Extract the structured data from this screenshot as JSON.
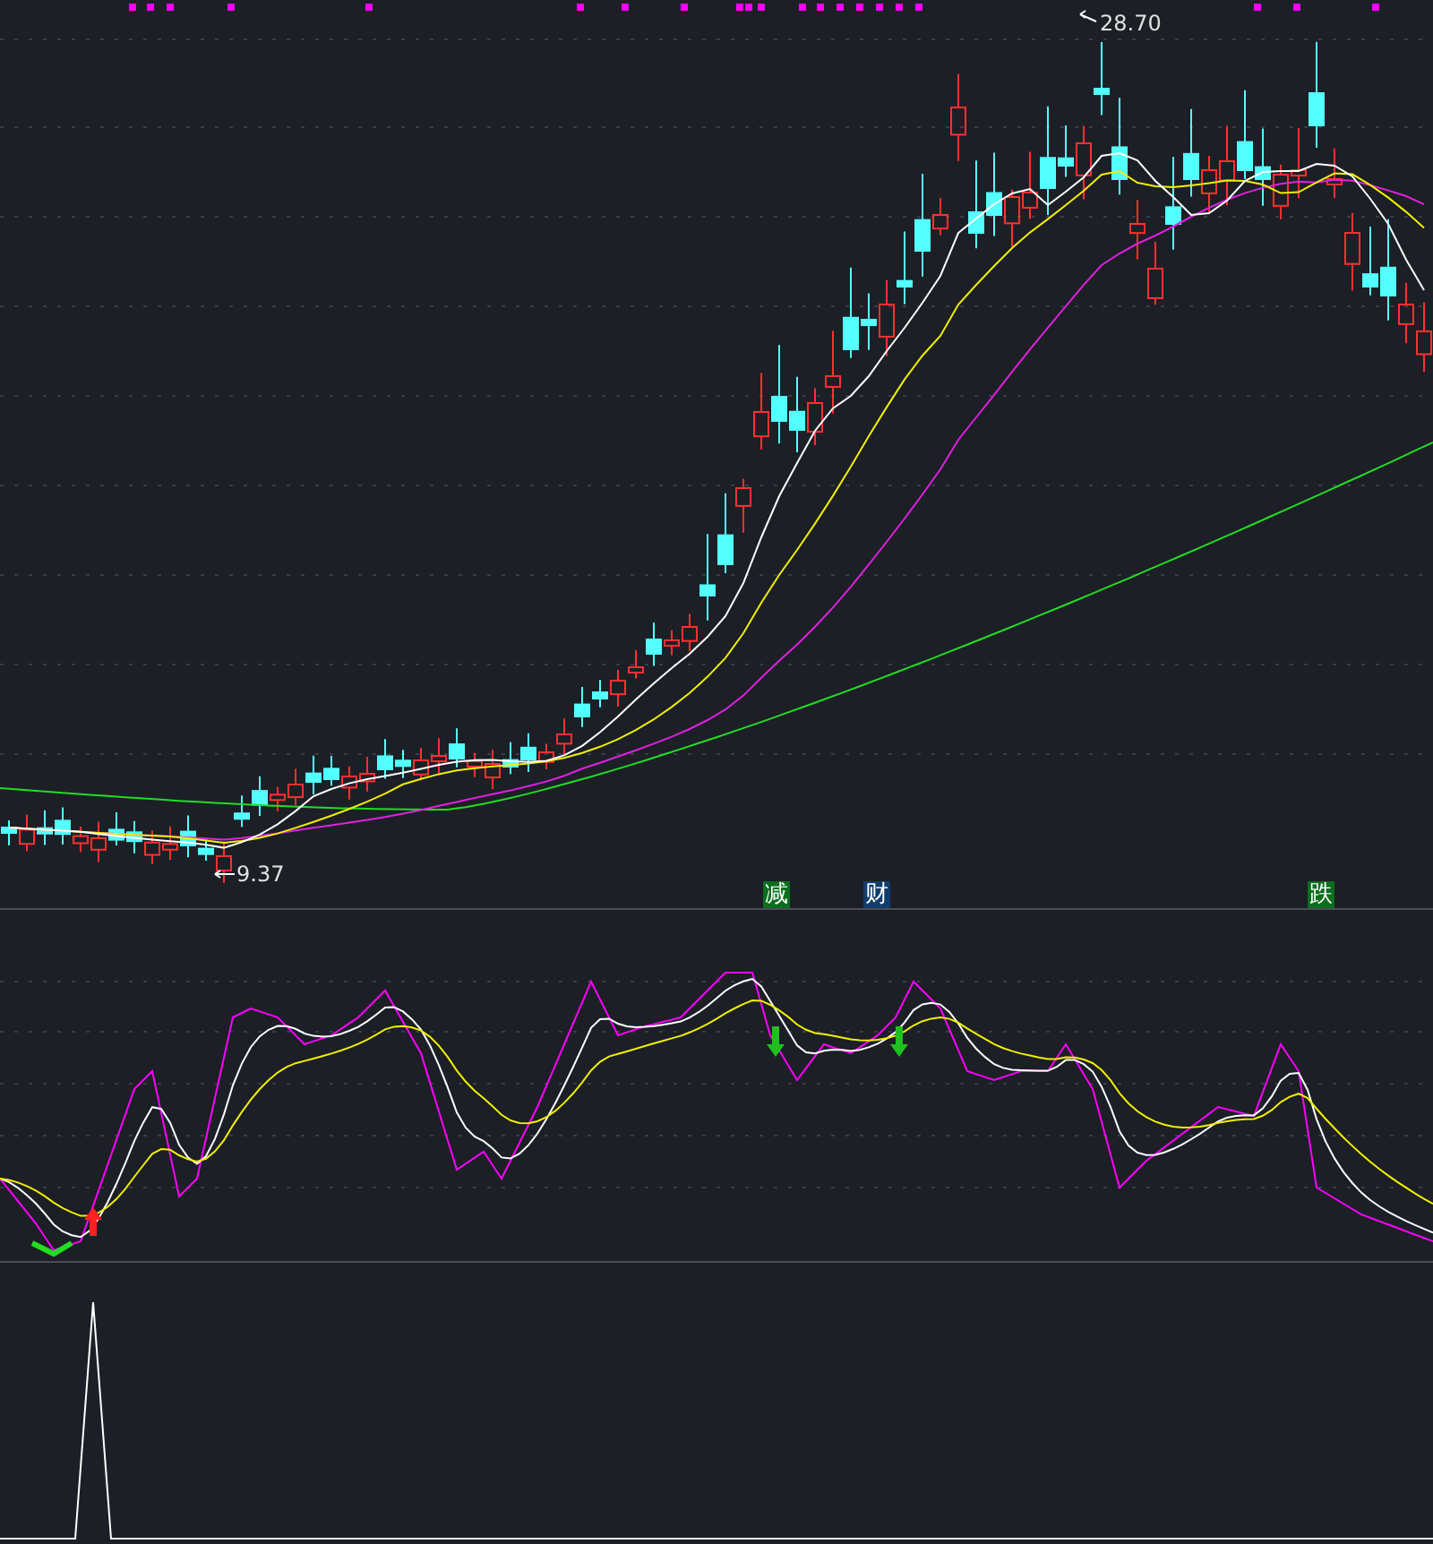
{
  "price_chart": {
    "high_label": "28.70",
    "low_label": "9.37"
  },
  "signals": [
    {
      "label": "减",
      "color": "#0b6e1e"
    },
    {
      "label": "财",
      "color": "#123d6b"
    },
    {
      "label": "跌",
      "color": "#0b6e1e"
    }
  ]
}
